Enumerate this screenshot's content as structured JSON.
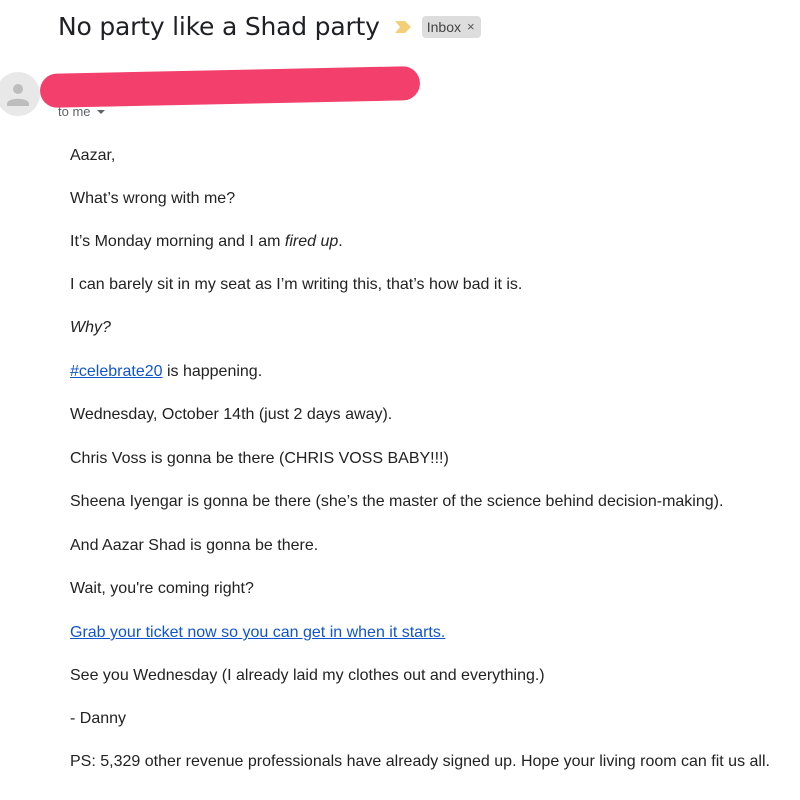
{
  "email": {
    "subject": "No party like a Shad party",
    "label": "Inbox",
    "label_close": "×",
    "recipient": "to me"
  },
  "body": {
    "greeting": "Aazar,",
    "p1": "What’s wrong with me?",
    "p2_start": "It’s Monday morning and I am ",
    "p2_emph": "fired up",
    "p2_end": ".",
    "p3": "I can barely sit in my seat as I’m writing this, that’s how bad it is.",
    "p4": "Why?",
    "p5_link": "#celebrate20",
    "p5_rest": " is happening.",
    "p6": "Wednesday, October 14th (just 2 days away).",
    "p7": "Chris Voss is gonna be there (CHRIS VOSS BABY!!!)",
    "p8": "Sheena Iyengar is gonna be there (she’s the master of the science behind decision-making).",
    "p9": "And Aazar Shad is gonna be there.",
    "p10": "Wait, you're coming right?",
    "p11_link": "Grab your ticket now so you can get in when it starts.",
    "p12": "See you Wednesday (I already laid my clothes out and everything.)",
    "p13": "- Danny",
    "p14": "PS: 5,329 other revenue professionals have already signed up. Hope your living room can fit us all."
  },
  "colors": {
    "link": "#1155cc",
    "importance_marker": "#f4cf7a",
    "redaction": "#f23f6b",
    "label_chip": "#dddddd"
  },
  "icons": {
    "importance": "importance-marker-icon",
    "avatar": "person-icon",
    "expand": "chevron-down-icon"
  }
}
